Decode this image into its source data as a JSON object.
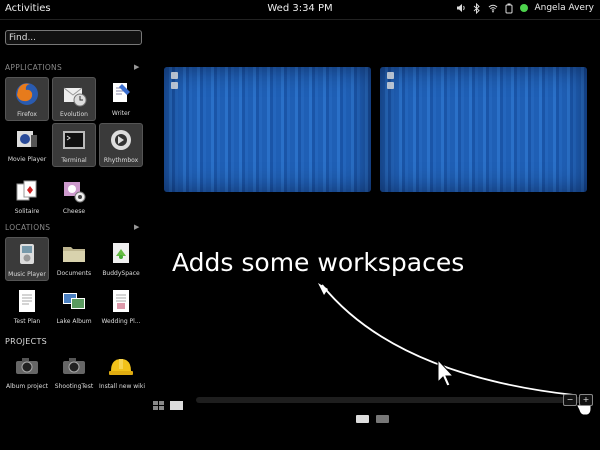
{
  "topbar": {
    "activities": "Activities",
    "clock": "Wed 3:34 PM",
    "user": "Angela Avery"
  },
  "search": {
    "placeholder": "Find..."
  },
  "sections": {
    "applications": "APPLICATIONS",
    "locations": "LOCATIONS",
    "projects": "PROJECTS"
  },
  "applications": [
    {
      "label": "Firefox",
      "icon": "firefox-icon"
    },
    {
      "label": "Evolution",
      "icon": "evolution-icon"
    },
    {
      "label": "Writer",
      "icon": "writer-icon"
    },
    {
      "label": "Movie Player",
      "icon": "movie-player-icon"
    },
    {
      "label": "Terminal",
      "icon": "terminal-icon"
    },
    {
      "label": "Rhythmbox",
      "icon": "rhythmbox-icon"
    },
    {
      "label": "Solitaire",
      "icon": "solitaire-icon"
    },
    {
      "label": "Cheese",
      "icon": "cheese-icon"
    }
  ],
  "locations": [
    {
      "label": "Music Player",
      "icon": "music-player-icon"
    },
    {
      "label": "Documents",
      "icon": "folder-icon"
    },
    {
      "label": "BuddySpace",
      "icon": "buddyspace-icon"
    },
    {
      "label": "Test Plan",
      "icon": "document-icon"
    },
    {
      "label": "Lake Album",
      "icon": "photo-album-icon"
    },
    {
      "label": "Wedding Pl...",
      "icon": "document-icon"
    }
  ],
  "projects": [
    {
      "label": "Album project",
      "icon": "camera-icon"
    },
    {
      "label": "ShootingTest",
      "icon": "camera-icon"
    },
    {
      "label": "Install new wiki",
      "icon": "hard-hat-icon"
    }
  ],
  "annotation": "Adds some workspaces",
  "workspace_controls": {
    "remove": "−",
    "add": "+"
  },
  "colors": {
    "workspace_blue": "#1f5fb5",
    "status_green": "#4cd34c",
    "panel_bg": "#000000"
  }
}
